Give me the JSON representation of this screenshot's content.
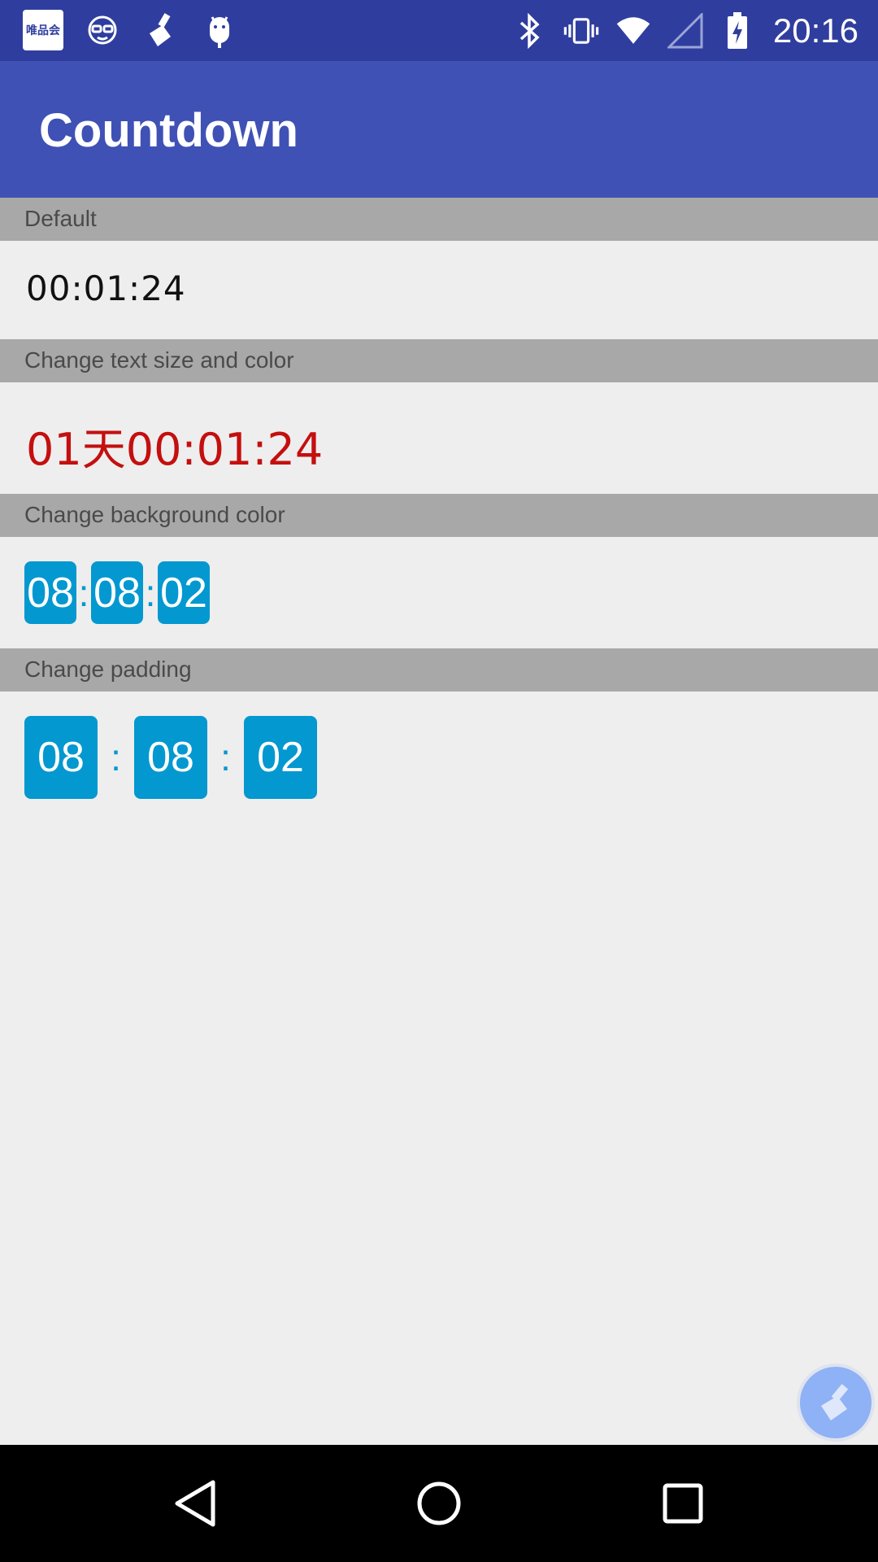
{
  "status_bar": {
    "app_badge": "唯品会",
    "left_icons": [
      "vipshop-icon",
      "glasses-face-icon",
      "broom-icon",
      "android-icon"
    ],
    "right_icons": [
      "bluetooth-icon",
      "vibrate-icon",
      "wifi-icon",
      "signal-icon",
      "battery-charging-icon"
    ],
    "time": "20:16"
  },
  "app_bar": {
    "title": "Countdown"
  },
  "sections": [
    {
      "header": "Default",
      "value": "00:01:24"
    },
    {
      "header": "Change text size and color",
      "value": "01天00:01:24",
      "color": "#c40f0f"
    },
    {
      "header": "Change background color",
      "hours": "08",
      "minutes": "08",
      "seconds": "02",
      "separator": ":",
      "bg_color": "#0398d0"
    },
    {
      "header": "Change padding",
      "hours": "08",
      "minutes": "08",
      "seconds": "02",
      "separator": ":",
      "bg_color": "#0398d0"
    }
  ],
  "nav_bar": {
    "buttons": [
      "back-icon",
      "home-icon",
      "recents-icon"
    ]
  },
  "floating_button": {
    "icon": "broom-icon"
  }
}
